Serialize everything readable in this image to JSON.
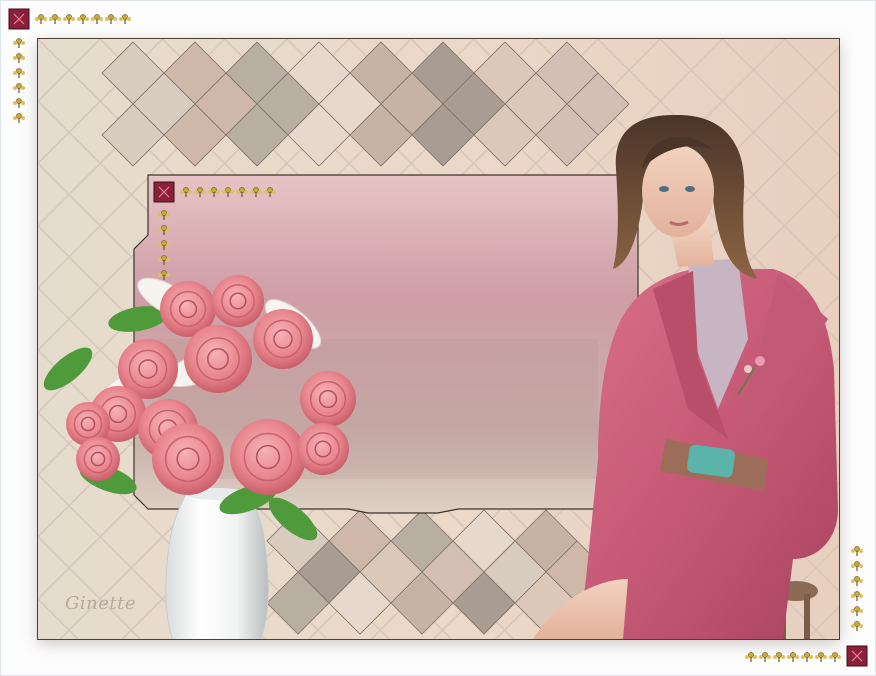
{
  "artwork": {
    "background_color": "#ead6c6",
    "panel_color": "#c48e96",
    "frame_color": "#4b4038",
    "tile_colors": [
      "#d8ccc0",
      "#cfb8aa",
      "#b9aea2",
      "#e6d8cc",
      "#c5b3a6",
      "#a99c92",
      "#dcc8bb",
      "#d4bfb5"
    ]
  },
  "signature": {
    "text": "Ginette"
  },
  "icons": {
    "corner_top_left": "red-square-ornament-icon",
    "corner_bottom_right": "red-square-ornament-icon",
    "panel_corner": "red-square-ornament-icon",
    "flourish": "gold-fleur-icon"
  }
}
